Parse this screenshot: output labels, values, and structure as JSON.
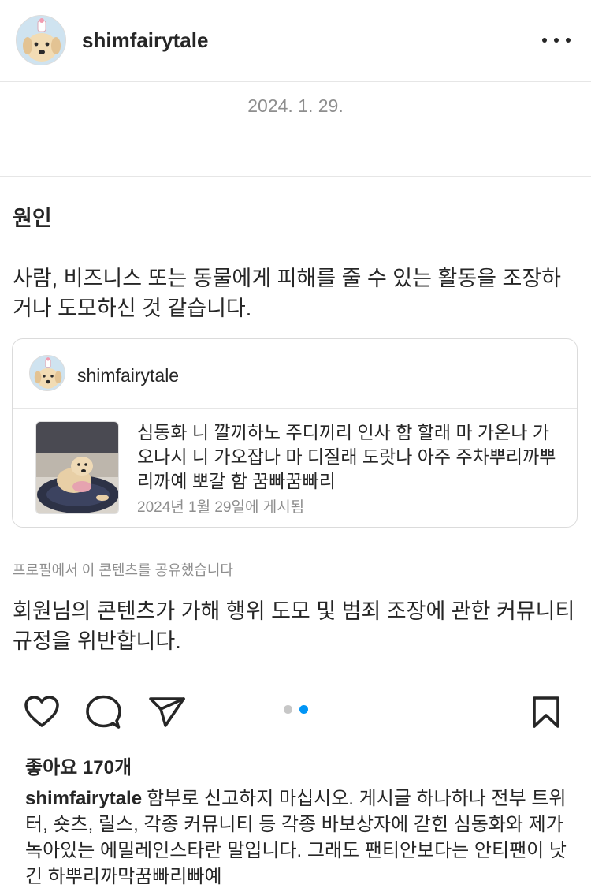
{
  "header": {
    "username": "shimfairytale",
    "avatar_icon": "dog-avatar-icon",
    "more_icon": "more-options-icon"
  },
  "date": "2024. 1. 29.",
  "reason": {
    "title": "원인",
    "text": "사람, 비즈니스 또는 동물에게 피해를 줄 수 있는 활동을 조장하거나 도모하신 것 같습니다."
  },
  "quoted_post": {
    "username": "shimfairytale",
    "text": "심동화 니 깔끼하노 주디끼리 인사 함 할래 마 가온나 가오나시 니 가오잡나 마 디질래 도랏나 아주 주차뿌리까뿌리까예 뽀갈 함 꿈빠꿈빠리",
    "posted_date": "2024년 1월 29일에 게시됨"
  },
  "shared_note": "프로필에서 이 콘텐츠를 공유했습니다",
  "violation_text": "회원님의 콘텐츠가 가해 행위 도모 및 범죄 조장에 관한 커뮤니티 규정을 위반합니다.",
  "actions": {
    "icons": [
      "heart-icon",
      "comment-icon",
      "share-icon",
      "bookmark-icon"
    ],
    "carousel_pages": 2,
    "carousel_active": 2
  },
  "likes": "좋아요 170개",
  "caption": {
    "username": "shimfairytale",
    "text": "함부로 신고하지 마십시오. 게시글 하나하나 전부 트위터, 숏츠, 릴스, 각종 커뮤니티 등 각종 바보상자에 갇힌 심동화와 제가 녹아있는 에밀레인스타란 말입니다. 그래도 팬티안보다는 안티팬이 낫긴 하뿌리까막꿈빠리빠예"
  },
  "colors": {
    "text": "#262626",
    "muted": "#8e8e8e",
    "divider": "#e6e6e6",
    "carousel_active": "#0095f6",
    "carousel_inactive": "#c7c7c7"
  }
}
